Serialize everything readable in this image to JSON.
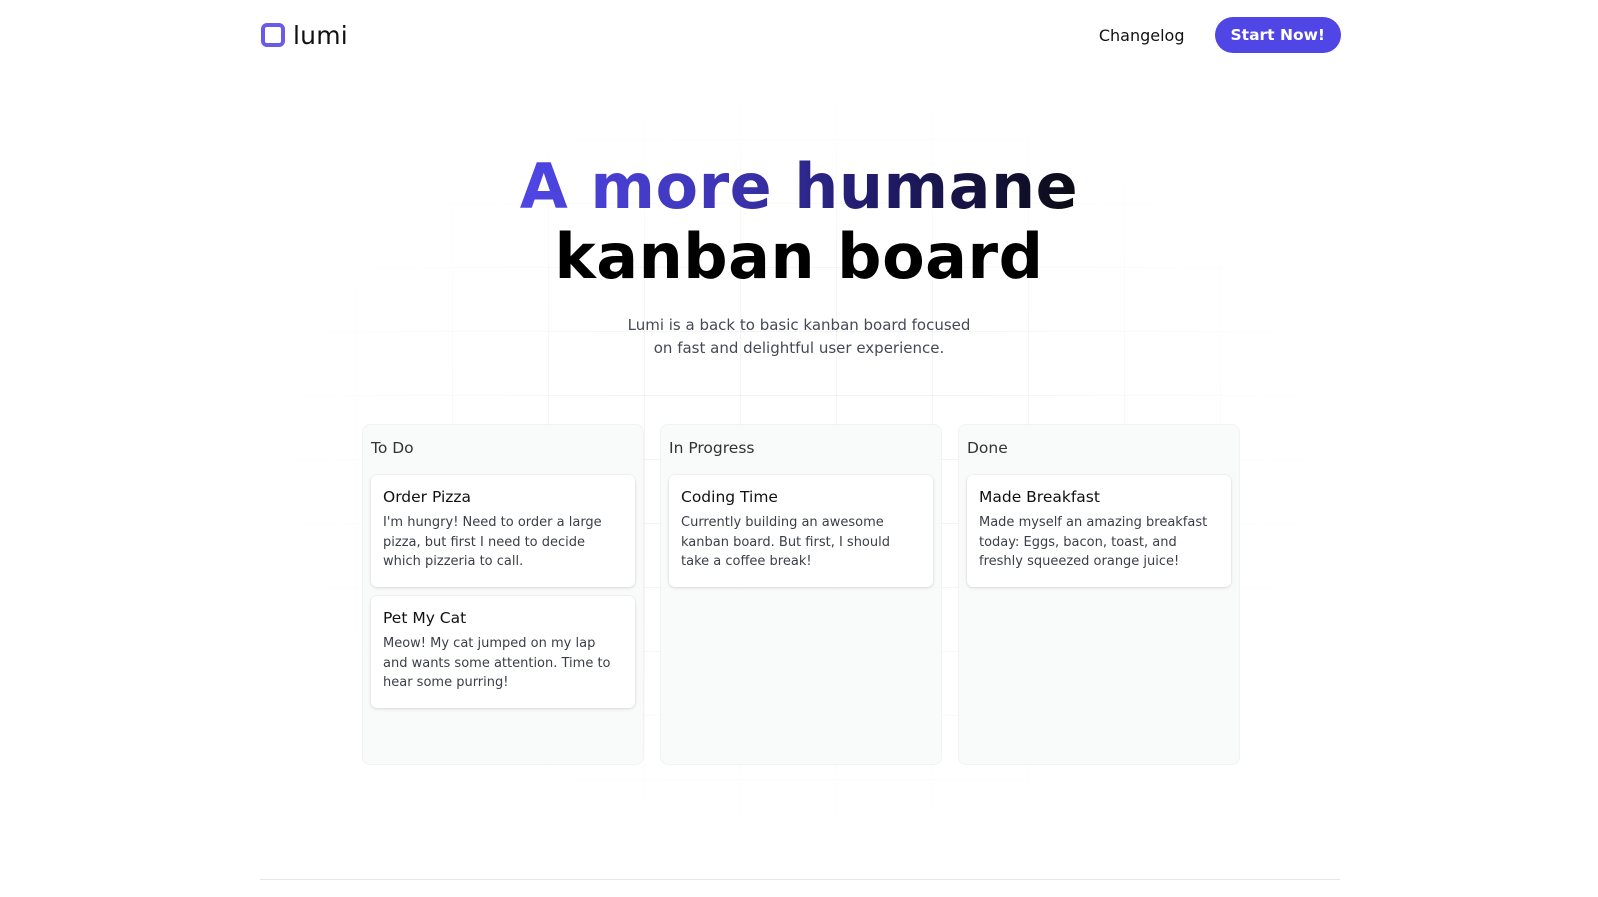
{
  "header": {
    "brand_name": "lumi",
    "nav_changelog": "Changelog",
    "cta_label": "Start Now!"
  },
  "hero": {
    "headline_line1": "A more humane",
    "headline_line2": "kanban board",
    "subtitle": "Lumi is a back to basic kanban board focused on fast and delightful user experience."
  },
  "board": {
    "columns": [
      {
        "title": "To Do",
        "cards": [
          {
            "title": "Order Pizza",
            "description": "I'm hungry! Need to order a large pizza, but first I need to decide which pizzeria to call."
          },
          {
            "title": "Pet My Cat",
            "description": "Meow! My cat jumped on my lap and wants some attention. Time to hear some purring!"
          }
        ]
      },
      {
        "title": "In Progress",
        "cards": [
          {
            "title": "Coding Time",
            "description": "Currently building an awesome kanban board. But first, I should take a coffee break!"
          }
        ]
      },
      {
        "title": "Done",
        "cards": [
          {
            "title": "Made Breakfast",
            "description": "Made myself an amazing breakfast today: Eggs, bacon, toast, and freshly squeezed orange juice!"
          }
        ]
      }
    ]
  },
  "colors": {
    "accent": "#4f46e5",
    "logo": "#6a5ce8"
  }
}
